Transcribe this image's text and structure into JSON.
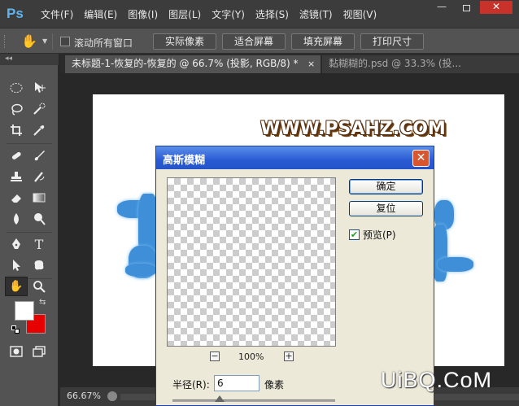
{
  "app": {
    "logo": "Ps"
  },
  "menu": [
    "文件(F)",
    "编辑(E)",
    "图像(I)",
    "图层(L)",
    "文字(Y)",
    "选择(S)",
    "滤镜(T)",
    "视图(V)"
  ],
  "window_controls": {
    "minimize": "—",
    "close": "✕"
  },
  "options_bar": {
    "scroll_all_label": "滚动所有窗口",
    "buttons": [
      "实际像素",
      "适合屏幕",
      "填充屏幕",
      "打印尺寸"
    ]
  },
  "toolpanel": {
    "collapse": "◂◂"
  },
  "tabs": [
    {
      "label": "未标题-1-恢复的-恢复的 @ 66.7% (投影, RGB/8) *",
      "close": "×"
    },
    {
      "label": "黏糊糊的.psd @ 33.3% (投...",
      "close": "×"
    }
  ],
  "canvas": {
    "watermark": "WWW.PSAHZ.COM"
  },
  "status": {
    "zoom": "66.67%"
  },
  "dialog": {
    "title": "高斯模糊",
    "close": "✕",
    "ok_label": "确定",
    "reset_label": "复位",
    "preview_label": "预览(P)",
    "preview_checked": true,
    "zoom_out": "−",
    "zoom_in": "+",
    "zoom_pct": "100%",
    "radius_label": "半径(R):",
    "radius_value": "6",
    "radius_unit": "像素"
  },
  "corner_logo": "UiBQ.CoM",
  "colors": {
    "foreground": "#ffffff",
    "background": "#e60000",
    "accent": "#2a5bd4"
  }
}
